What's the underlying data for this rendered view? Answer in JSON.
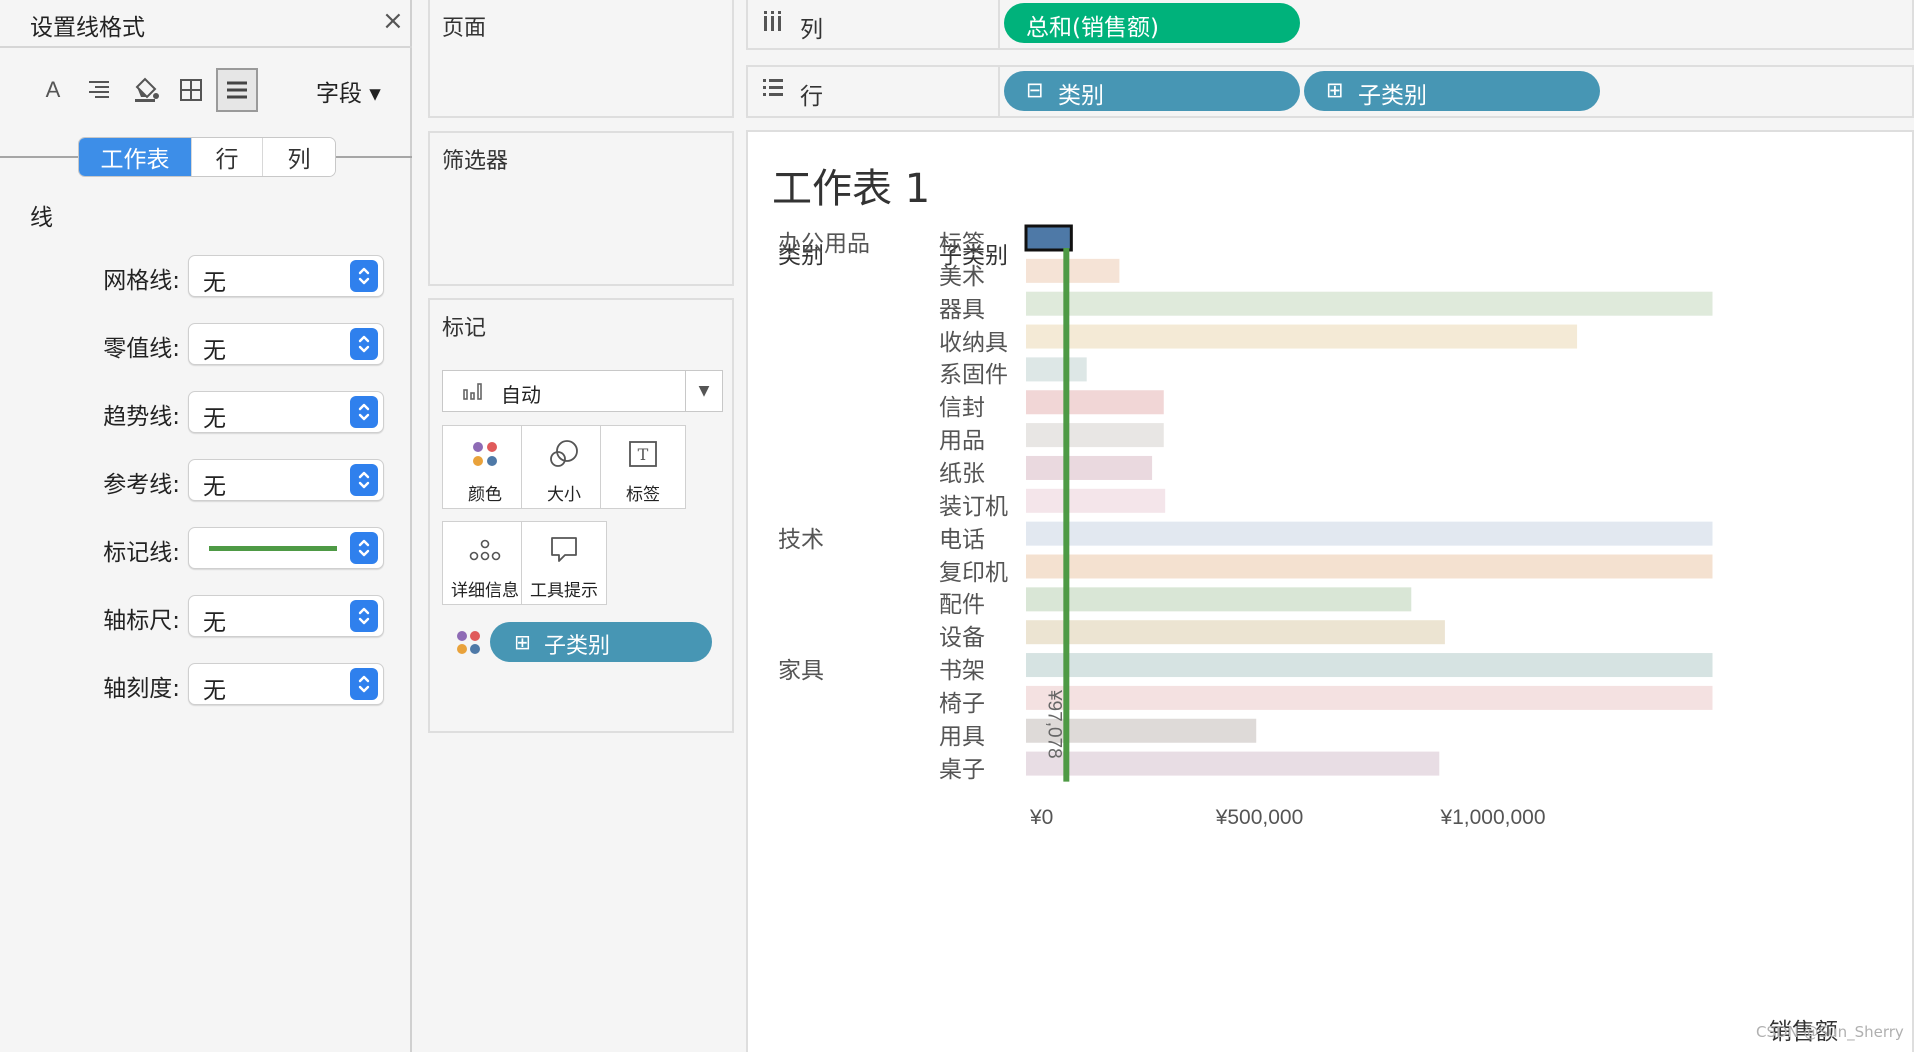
{
  "format_panel": {
    "title": "设置线格式",
    "close_symbol": "×",
    "field_dropdown": "字段 ▾",
    "scope_tabs": [
      {
        "label": "工作表",
        "active": true
      },
      {
        "label": "行",
        "active": false
      },
      {
        "label": "列",
        "active": false
      }
    ],
    "section_title": "线",
    "settings": [
      {
        "label": "网格线:",
        "value": "无"
      },
      {
        "label": "零值线:",
        "value": "无"
      },
      {
        "label": "趋势线:",
        "value": "无"
      },
      {
        "label": "参考线:",
        "value": "无"
      },
      {
        "label": "标记线:",
        "value": "",
        "swatch_color": "#4e9a45"
      },
      {
        "label": "轴标尺:",
        "value": "无"
      },
      {
        "label": "轴刻度:",
        "value": "无"
      }
    ]
  },
  "cards": {
    "pages": "页面",
    "filters": "筛选器",
    "marks": {
      "title": "标记",
      "mark_type": "自动",
      "buttons": [
        {
          "label": "颜色",
          "icon": "color-dots-icon"
        },
        {
          "label": "大小",
          "icon": "size-circles-icon"
        },
        {
          "label": "标签",
          "icon": "text-label-icon"
        },
        {
          "label": "详细信息",
          "icon": "detail-dots-icon"
        },
        {
          "label": "工具提示",
          "icon": "tooltip-bubble-icon"
        }
      ],
      "color_pill": "子类别"
    }
  },
  "shelves": {
    "columns": {
      "label": "列",
      "pills": [
        "总和(销售额)"
      ]
    },
    "rows": {
      "label": "行",
      "pills": [
        "类别",
        "子类别"
      ]
    }
  },
  "worksheet": {
    "title": "工作表 1",
    "header_category": "类别",
    "header_subcategory": "子类别",
    "reference_label": "¥97,078",
    "x_axis_title": "销售额",
    "watermark": "CSDN @Sun_Sherry"
  },
  "chart_data": {
    "type": "bar",
    "orientation": "horizontal",
    "xlabel": "销售额",
    "x_ticks": [
      0,
      500000,
      1000000
    ],
    "x_tick_labels": [
      "¥0",
      "¥500,000",
      "¥1,000,000"
    ],
    "xlim": [
      0,
      1470000
    ],
    "reference_line": {
      "value": 97078,
      "label": "¥97,078",
      "color": "#4e9a45"
    },
    "categories": [
      "办公用品",
      "技术",
      "家具"
    ],
    "rows": [
      {
        "category": "办公用品",
        "subcategory": "标签",
        "value": 97078,
        "color": "#4e79a7",
        "highlighted": true
      },
      {
        "category": "办公用品",
        "subcategory": "美术",
        "value": 200000,
        "color": "#f5e3d6"
      },
      {
        "category": "办公用品",
        "subcategory": "器具",
        "value": 1470000,
        "color": "#dfeadb"
      },
      {
        "category": "办公用品",
        "subcategory": "收纳具",
        "value": 1180000,
        "color": "#f4ead6"
      },
      {
        "category": "办公用品",
        "subcategory": "系固件",
        "value": 130000,
        "color": "#dde7e6"
      },
      {
        "category": "办公用品",
        "subcategory": "信封",
        "value": 295000,
        "color": "#f1d6d6"
      },
      {
        "category": "办公用品",
        "subcategory": "用品",
        "value": 295000,
        "color": "#e8e6e4"
      },
      {
        "category": "办公用品",
        "subcategory": "纸张",
        "value": 270000,
        "color": "#ead9df"
      },
      {
        "category": "办公用品",
        "subcategory": "装订机",
        "value": 298000,
        "color": "#f4e5ea"
      },
      {
        "category": "技术",
        "subcategory": "电话",
        "value": 1470000,
        "color": "#e2e8f0"
      },
      {
        "category": "技术",
        "subcategory": "复印机",
        "value": 1470000,
        "color": "#f4e1d0"
      },
      {
        "category": "技术",
        "subcategory": "配件",
        "value": 825000,
        "color": "#d9e6d6"
      },
      {
        "category": "技术",
        "subcategory": "设备",
        "value": 897000,
        "color": "#ece4d2"
      },
      {
        "category": "家具",
        "subcategory": "书架",
        "value": 1470000,
        "color": "#d6e3e2"
      },
      {
        "category": "家具",
        "subcategory": "椅子",
        "value": 1470000,
        "color": "#f4e1e1"
      },
      {
        "category": "家具",
        "subcategory": "用具",
        "value": 493000,
        "color": "#dedad8"
      },
      {
        "category": "家具",
        "subcategory": "桌子",
        "value": 885000,
        "color": "#e8dde4"
      }
    ]
  },
  "colors": {
    "accent_blue": "#3d8ee8",
    "pill_green": "#00b27b",
    "pill_blue": "#4796b4",
    "mark_line": "#4e9a45"
  }
}
